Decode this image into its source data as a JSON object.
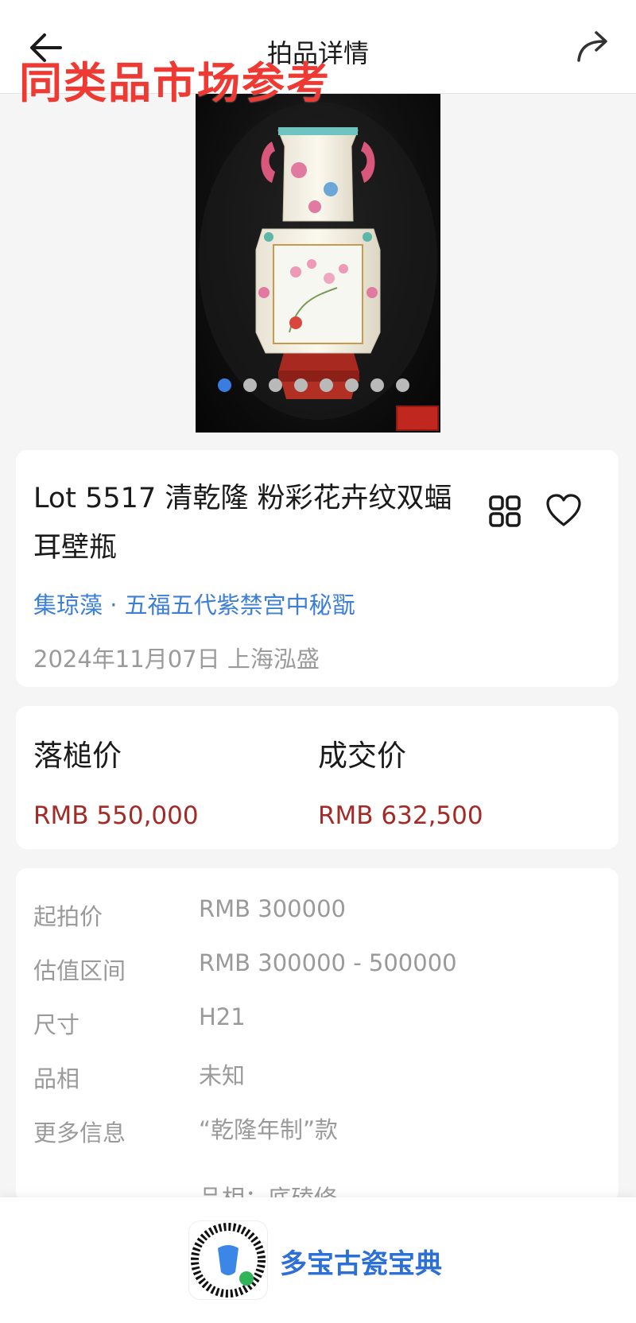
{
  "header": {
    "title": "拍品详情"
  },
  "watermark": {
    "text": "同类品市场参考"
  },
  "gallery": {
    "image_count": 8,
    "active_index": 0
  },
  "lot": {
    "title": "Lot 5517 清乾隆 粉彩花卉纹双蝠耳壁瓶",
    "collection": "集琼藻 · 五福五代紫禁宫中秘翫",
    "date_house": "2024年11月07日 上海泓盛"
  },
  "prices": {
    "hammer_label": "落槌价",
    "hammer_value": "RMB 550,000",
    "sold_label": "成交价",
    "sold_value": "RMB 632,500"
  },
  "details": [
    {
      "key": "起拍价",
      "value": "RMB 300000"
    },
    {
      "key": "估值区间",
      "value": "RMB 300000 - 500000"
    },
    {
      "key": "尺寸",
      "value": "H21"
    },
    {
      "key": "品相",
      "value": "未知"
    },
    {
      "key": "更多信息",
      "value": "“乾隆年制”款"
    }
  ],
  "details_extra": "品相：底磕修",
  "footer": {
    "brand": "多宝古瓷宝典"
  },
  "colors": {
    "accent_blue": "#3d7fd6",
    "price_red": "#a22b27",
    "watermark_red": "#ee3a33",
    "brand_blue": "#2c6fd6"
  }
}
